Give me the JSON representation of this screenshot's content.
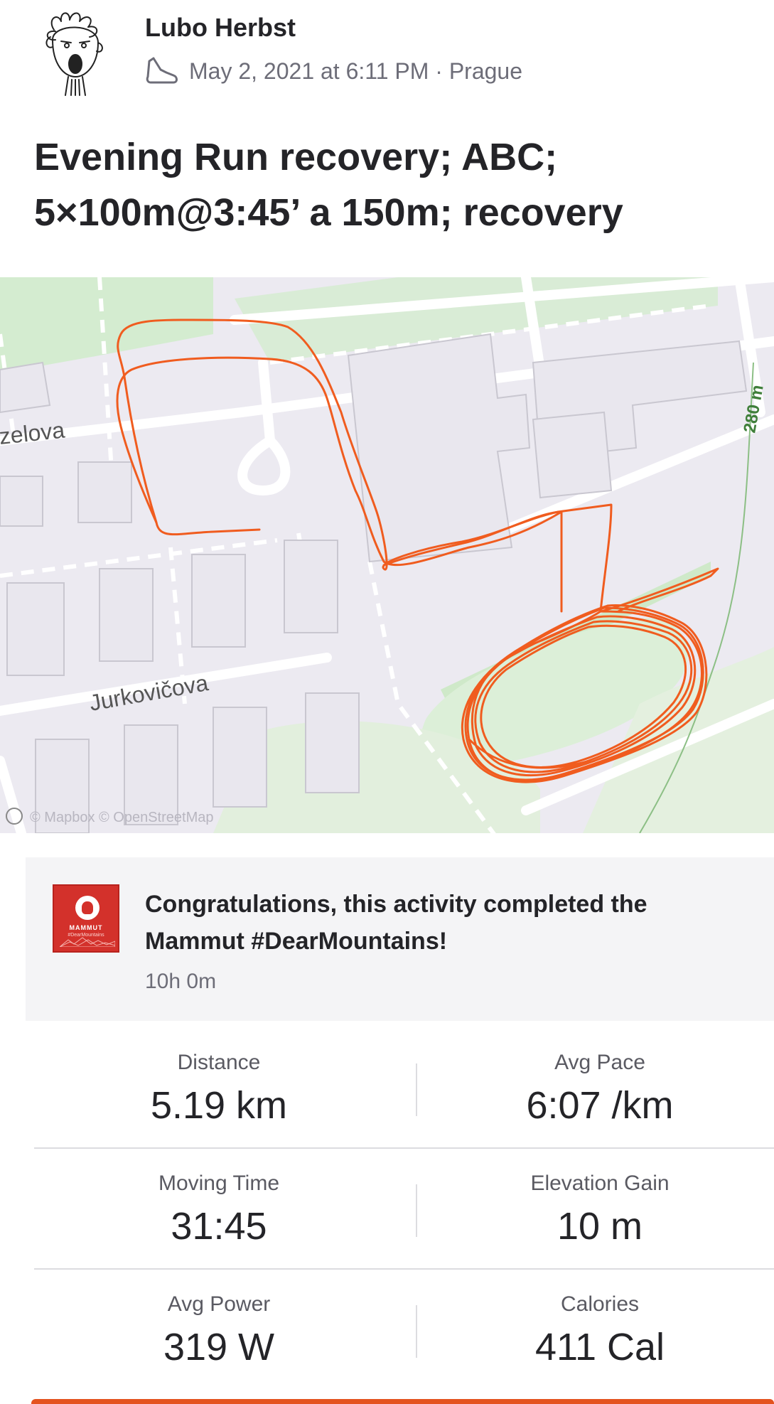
{
  "author": {
    "name": "Lubo Herbst",
    "avatar_icon": "screaming-face-avatar"
  },
  "meta": {
    "sport_icon": "running-shoe-icon",
    "text": "May 2, 2021 at 6:11 PM · Prague"
  },
  "activity": {
    "title": "Evening Run recovery; ABC; 5×100m@3:45’ a 150m; recovery"
  },
  "map": {
    "streets": [
      "zelova",
      "Jurkovičova"
    ],
    "contour_label": "280 m",
    "attribution": "© Mapbox © OpenStreetMap",
    "route_color": "#f05c1f",
    "green_color": "#cfe9c9"
  },
  "challenge": {
    "badge_brand": "MAMMUT",
    "badge_tag": "#DearMountains",
    "text": "Congratulations, this activity completed the Mammut #DearMountains!",
    "time": "10h 0m"
  },
  "stats": [
    {
      "label": "Distance",
      "value": "5.19 km"
    },
    {
      "label": "Avg Pace",
      "value": "6:07 /km"
    },
    {
      "label": "Moving Time",
      "value": "31:45"
    },
    {
      "label": "Elevation Gain",
      "value": "10 m"
    },
    {
      "label": "Avg Power",
      "value": "319 W"
    },
    {
      "label": "Calories",
      "value": "411 Cal"
    }
  ],
  "colors": {
    "accent": "#e4531f",
    "text": "#242428",
    "muted": "#6d6d78"
  }
}
